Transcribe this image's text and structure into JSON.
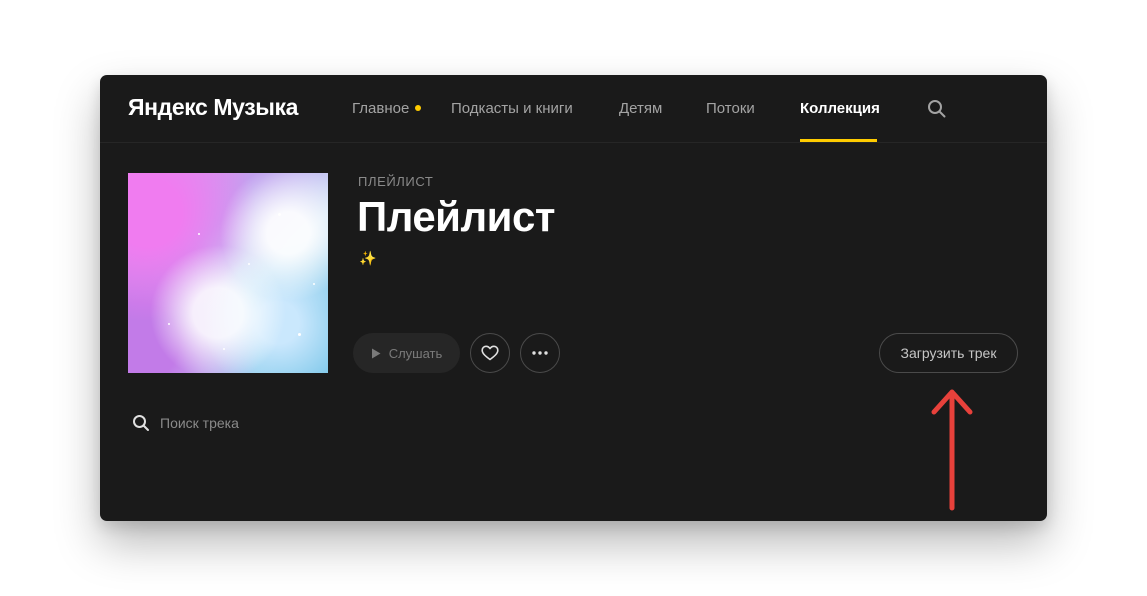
{
  "app": {
    "logo": "Яндекс Музыка"
  },
  "nav": {
    "items": [
      {
        "label": "Главное",
        "has_dot": true
      },
      {
        "label": "Подкасты и книги"
      },
      {
        "label": "Детям"
      },
      {
        "label": "Потоки"
      },
      {
        "label": "Коллекция",
        "active": true
      }
    ],
    "search_icon": "search-icon"
  },
  "playlist": {
    "eyebrow": "ПЛЕЙЛИСТ",
    "title": "Плейлист",
    "description": "✨"
  },
  "actions": {
    "play_label": "Слушать",
    "like_icon": "heart-icon",
    "more_icon": "more-dots-icon",
    "upload_label": "Загрузить трек"
  },
  "track_search": {
    "placeholder": "Поиск трека"
  },
  "annotation": {
    "arrow_color": "#e8413b"
  },
  "colors": {
    "background": "#1a1a1a",
    "accent": "#ffcc00",
    "text_primary": "#ffffff",
    "text_muted": "#8a8a8a"
  }
}
